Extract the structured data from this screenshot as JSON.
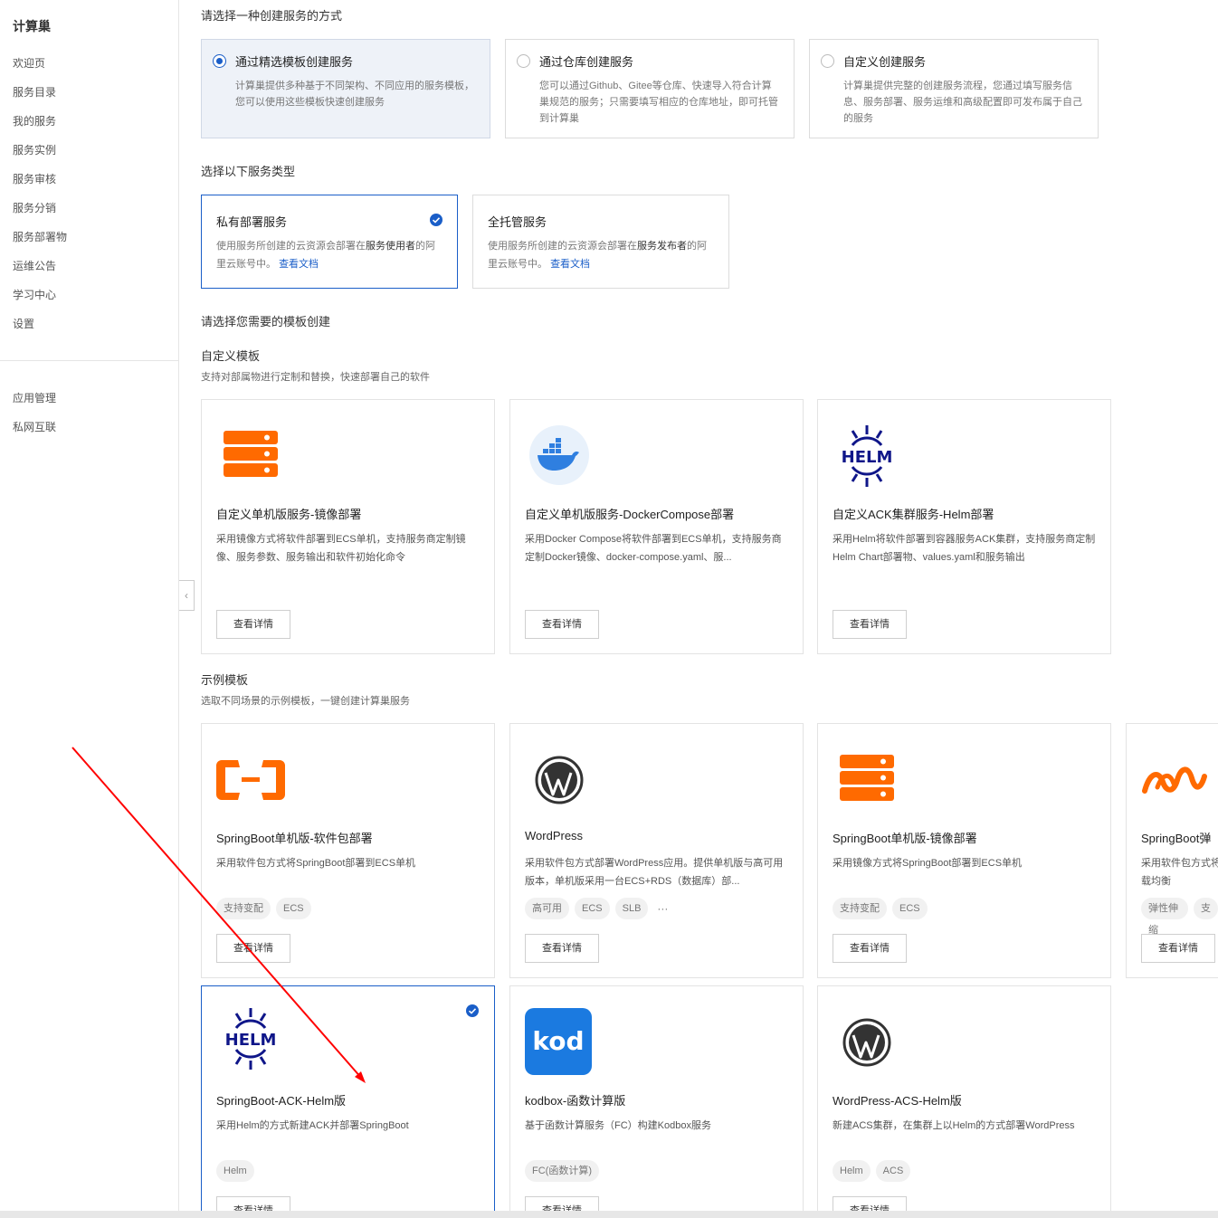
{
  "sidebar": {
    "title": "计算巢",
    "items": [
      "欢迎页",
      "服务目录",
      "我的服务",
      "服务实例",
      "服务审核",
      "服务分销",
      "服务部署物",
      "运维公告",
      "学习中心",
      "设置"
    ],
    "items2": [
      "应用管理",
      "私网互联"
    ],
    "collapse_icon": "‹"
  },
  "method_section": {
    "label": "请选择一种创建服务的方式",
    "cards": [
      {
        "title": "通过精选模板创建服务",
        "desc": "计算巢提供多种基于不同架构、不同应用的服务模板，您可以使用这些模板快速创建服务",
        "selected": true
      },
      {
        "title": "通过仓库创建服务",
        "desc": "您可以通过Github、Gitee等仓库、快速导入符合计算巢规范的服务；只需要填写相应的仓库地址，即可托管到计算巢",
        "selected": false
      },
      {
        "title": "自定义创建服务",
        "desc": "计算巢提供完整的创建服务流程，您通过填写服务信息、服务部署、服务运维和高级配置即可发布属于自己的服务",
        "selected": false
      }
    ]
  },
  "type_section": {
    "label": "选择以下服务类型",
    "cards": [
      {
        "title": "私有部署服务",
        "desc_a": "使用服务所创建的云资源会部署在",
        "desc_b": "服务使用者",
        "desc_c": "的阿里云账号中。",
        "link": "查看文档",
        "selected": true
      },
      {
        "title": "全托管服务",
        "desc_a": "使用服务所创建的云资源会部署在",
        "desc_b": "服务发布者",
        "desc_c": "的阿里云账号中。",
        "link": "查看文档",
        "selected": false
      }
    ]
  },
  "template_section": {
    "label": "请选择您需要的模板创建",
    "custom": {
      "title": "自定义模板",
      "desc": "支持对部属物进行定制和替换，快速部署自己的软件",
      "cards": [
        {
          "logo": "server-stack-icon",
          "title": "自定义单机版服务-镜像部署",
          "desc": "采用镜像方式将软件部署到ECS单机，支持服务商定制镜像、服务参数、服务输出和软件初始化命令",
          "button": "查看详情"
        },
        {
          "logo": "docker-icon",
          "title": "自定义单机版服务-DockerCompose部署",
          "desc": "采用Docker Compose将软件部署到ECS单机，支持服务商定制Docker镜像、docker-compose.yaml、服...",
          "button": "查看详情"
        },
        {
          "logo": "helm-icon",
          "title": "自定义ACK集群服务-Helm部署",
          "desc": "采用Helm将软件部署到容器服务ACK集群，支持服务商定制Helm Chart部署物、values.yaml和服务输出",
          "button": "查看详情"
        }
      ]
    },
    "example": {
      "title": "示例模板",
      "desc": "选取不同场景的示例模板，一键创建计算巢服务",
      "cards": [
        {
          "logo": "aliyun-icon",
          "title": "SpringBoot单机版-软件包部署",
          "desc": "采用软件包方式将SpringBoot部署到ECS单机",
          "tags": [
            "支持变配",
            "ECS"
          ],
          "more": "",
          "button": "查看详情"
        },
        {
          "logo": "wordpress-icon",
          "title": "WordPress",
          "desc": "采用软件包方式部署WordPress应用。提供单机版与高可用版本，单机版采用一台ECS+RDS（数据库）部...",
          "tags": [
            "高可用",
            "ECS",
            "SLB"
          ],
          "more": "···",
          "button": "查看详情"
        },
        {
          "logo": "server-stack-icon",
          "title": "SpringBoot单机版-镜像部署",
          "desc": "采用镜像方式将SpringBoot部署到ECS单机",
          "tags": [
            "支持变配",
            "ECS"
          ],
          "more": "",
          "button": "查看详情"
        },
        {
          "logo": "springboot-swirl-icon",
          "title": "SpringBoot弹",
          "desc": "采用软件包方式将SpringBoot部署到ECS上，并使用SLB做负载均衡",
          "tags": [
            "弹性伸缩",
            "支"
          ],
          "more": "",
          "button": "查看详情"
        },
        {
          "logo": "helm-icon",
          "title": "SpringBoot-ACK-Helm版",
          "desc": "采用Helm的方式新建ACK并部署SpringBoot",
          "tags": [
            "Helm"
          ],
          "more": "",
          "button": "查看详情",
          "selected": true
        },
        {
          "logo": "kodbox-icon",
          "title": "kodbox-函数计算版",
          "desc": "基于函数计算服务（FC）构建Kodbox服务",
          "tags": [
            "FC(函数计算)"
          ],
          "more": "",
          "button": "查看详情"
        },
        {
          "logo": "wordpress-icon",
          "title": "WordPress-ACS-Helm版",
          "desc": "新建ACS集群，在集群上以Helm的方式部署WordPress",
          "tags": [
            "Helm",
            "ACS"
          ],
          "more": "",
          "button": "查看详情"
        }
      ]
    }
  },
  "logos": {
    "helm_text": "HELM",
    "kod_text": "kod"
  },
  "colors": {
    "accent": "#1a5ec8",
    "orange": "#ff6a00",
    "helm": "#0f1689",
    "annotation": "#ff0000"
  }
}
